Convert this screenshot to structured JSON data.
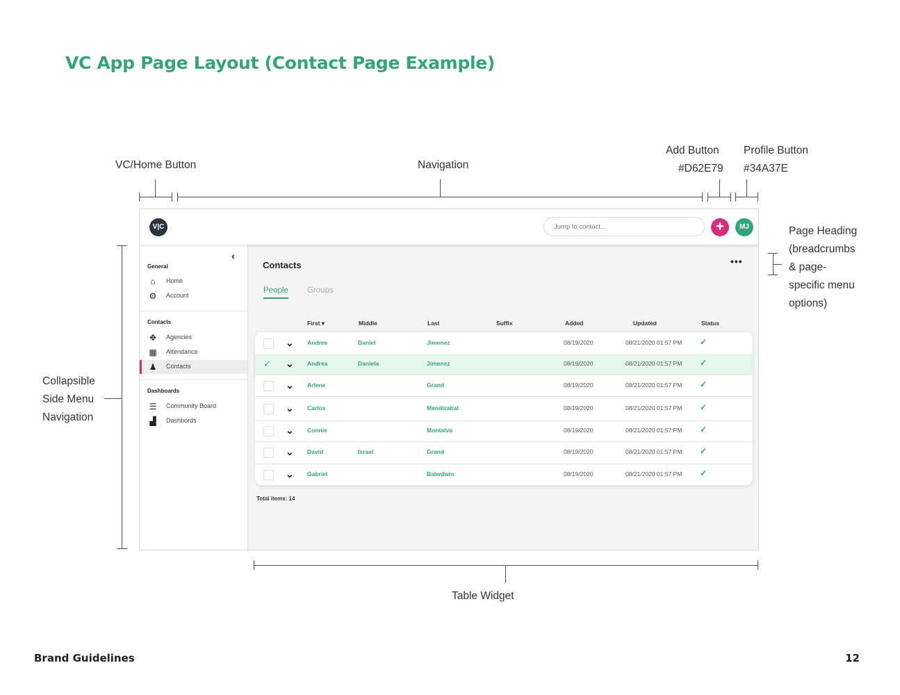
{
  "page": {
    "title": "VC App Page Layout (Contact Page Example)",
    "footer_left": "Brand Guidelines",
    "footer_right": "12"
  },
  "annotations": {
    "home_button": "VC/Home Button",
    "navigation": "Navigation",
    "add_button": "Add Button",
    "add_button_color": "#D62E79",
    "profile_button": "Profile Button",
    "profile_button_color": "#34A37E",
    "page_heading": [
      "Page Heading",
      "(breadcrumbs",
      "& page-",
      "specific menu",
      "options)"
    ],
    "side_menu": [
      "Collapsible",
      "Side Menu",
      "Navigation"
    ],
    "table_widget": "Table Widget"
  },
  "app": {
    "logo": "V|C",
    "search_placeholder": "Jump to contact...",
    "add_icon": "+",
    "profile_initials": "MJ",
    "colors": {
      "accent": "#34A37E",
      "add": "#D62E79"
    },
    "sidebar": {
      "collapse_icon": "‹",
      "sections": [
        {
          "label": "General",
          "items": [
            {
              "label": "Home",
              "icon": "home-icon",
              "glyph": "⌂"
            },
            {
              "label": "Account",
              "icon": "gears-icon",
              "glyph": "⚙"
            }
          ]
        },
        {
          "label": "Contacts",
          "items": [
            {
              "label": "Agencies",
              "icon": "group-icon",
              "glyph": "✥"
            },
            {
              "label": "Attendance",
              "icon": "calendar-icon",
              "glyph": "▦"
            },
            {
              "label": "Contacts",
              "icon": "person-icon",
              "glyph": "♟",
              "active": true
            }
          ]
        },
        {
          "label": "Dashboards",
          "items": [
            {
              "label": "Community Board",
              "icon": "list-icon",
              "glyph": "☰"
            },
            {
              "label": "Dashbords",
              "icon": "bar-chart-icon",
              "glyph": "▟"
            }
          ]
        }
      ]
    },
    "main": {
      "title": "Contacts",
      "more_icon": "•••",
      "tabs": [
        "People",
        "Groups"
      ],
      "columns": [
        "First ▾",
        "Middle",
        "Last",
        "Suffix",
        "Added",
        "Updated",
        "Status"
      ],
      "rows": [
        {
          "first": "Andres",
          "middle": "Daniel",
          "last": "Jimenez",
          "suffix": "",
          "added": "08/19/2020",
          "updated": "08/21/2020 01:57 PM",
          "status": "✓",
          "selected": false
        },
        {
          "first": "Andrea",
          "middle": "Daniela",
          "last": "Jimenez",
          "suffix": "",
          "added": "08/19/2020",
          "updated": "08/21/2020 01:57 PM",
          "status": "✓",
          "selected": true
        },
        {
          "first": "Arlene",
          "middle": "",
          "last": "Grand",
          "suffix": "",
          "added": "08/19/2020",
          "updated": "08/21/2020 01:57 PM",
          "status": "✓",
          "selected": false
        },
        {
          "first": "Carlos",
          "middle": "",
          "last": "Mendizabal",
          "suffix": "",
          "added": "08/19/2020",
          "updated": "08/21/2020 01:57 PM",
          "status": "✓",
          "selected": false
        },
        {
          "first": "Connie",
          "middle": "",
          "last": "Montalvo",
          "suffix": "",
          "added": "08/19/2020",
          "updated": "08/21/2020 01:57 PM",
          "status": "✓",
          "selected": false
        },
        {
          "first": "David",
          "middle": "Israel",
          "last": "Grand",
          "suffix": "",
          "added": "08/19/2020",
          "updated": "08/21/2020 01:57 PM",
          "status": "✓",
          "selected": false
        },
        {
          "first": "Gabriel",
          "middle": "",
          "last": "Balwdwin",
          "suffix": "",
          "added": "08/19/2020",
          "updated": "08/21/2020 01:57 PM",
          "status": "✓",
          "selected": false
        }
      ],
      "total": "Total items: 14"
    }
  }
}
